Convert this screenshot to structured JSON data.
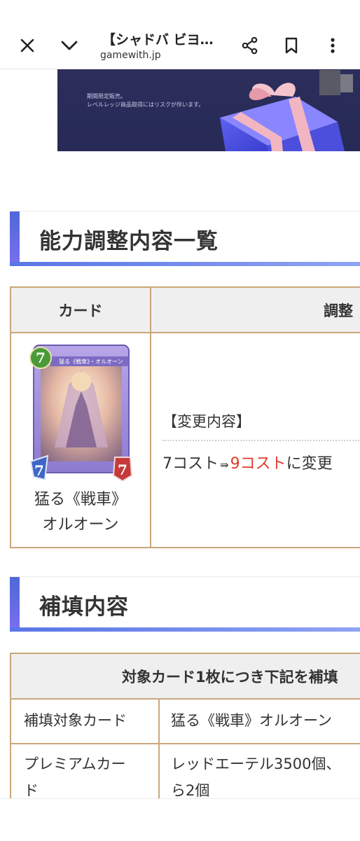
{
  "browser": {
    "title": "【シャドバ ビヨン…",
    "url": "gamewith.jp",
    "close_icon": "close-icon",
    "collapse_icon": "chevron-down-icon",
    "share_icon": "share-icon",
    "bookmark_icon": "bookmark-icon",
    "menu_icon": "more-vertical-icon"
  },
  "banner": {
    "line1": "期間限定販売。",
    "line2": "レベルレッジ商品取得にはリスクが伴います。"
  },
  "section1": {
    "heading": "能力調整内容一覧",
    "table": {
      "headers": [
        "カード",
        "調整"
      ],
      "card_cost": "7",
      "card_title": "猛る《戦車》・オルオーン",
      "card_atk": "7",
      "card_def": "7",
      "card_name_line1": "猛る《戦車》",
      "card_name_line2": "オルオーン",
      "change_heading": "【変更内容】",
      "change_before": "7コスト",
      "change_arrow": "⇛",
      "change_after": "9コスト",
      "change_suffix": "に変更"
    }
  },
  "section2": {
    "heading": "補填内容",
    "table": {
      "header": "対象カード1枚につき下記を補填",
      "rows": [
        {
          "label": "補填対象カード",
          "value": "猛る《戦車》オルオーン"
        },
        {
          "label_line1": "プレミアムカー",
          "label_line2": "ド",
          "value_line1": "レッドエーテル3500個、",
          "value_line2": "ら2個"
        }
      ]
    }
  },
  "colors": {
    "accent_blue": "#5a75e6",
    "table_border": "#c9a77a",
    "highlight_red": "#e23b2a"
  }
}
